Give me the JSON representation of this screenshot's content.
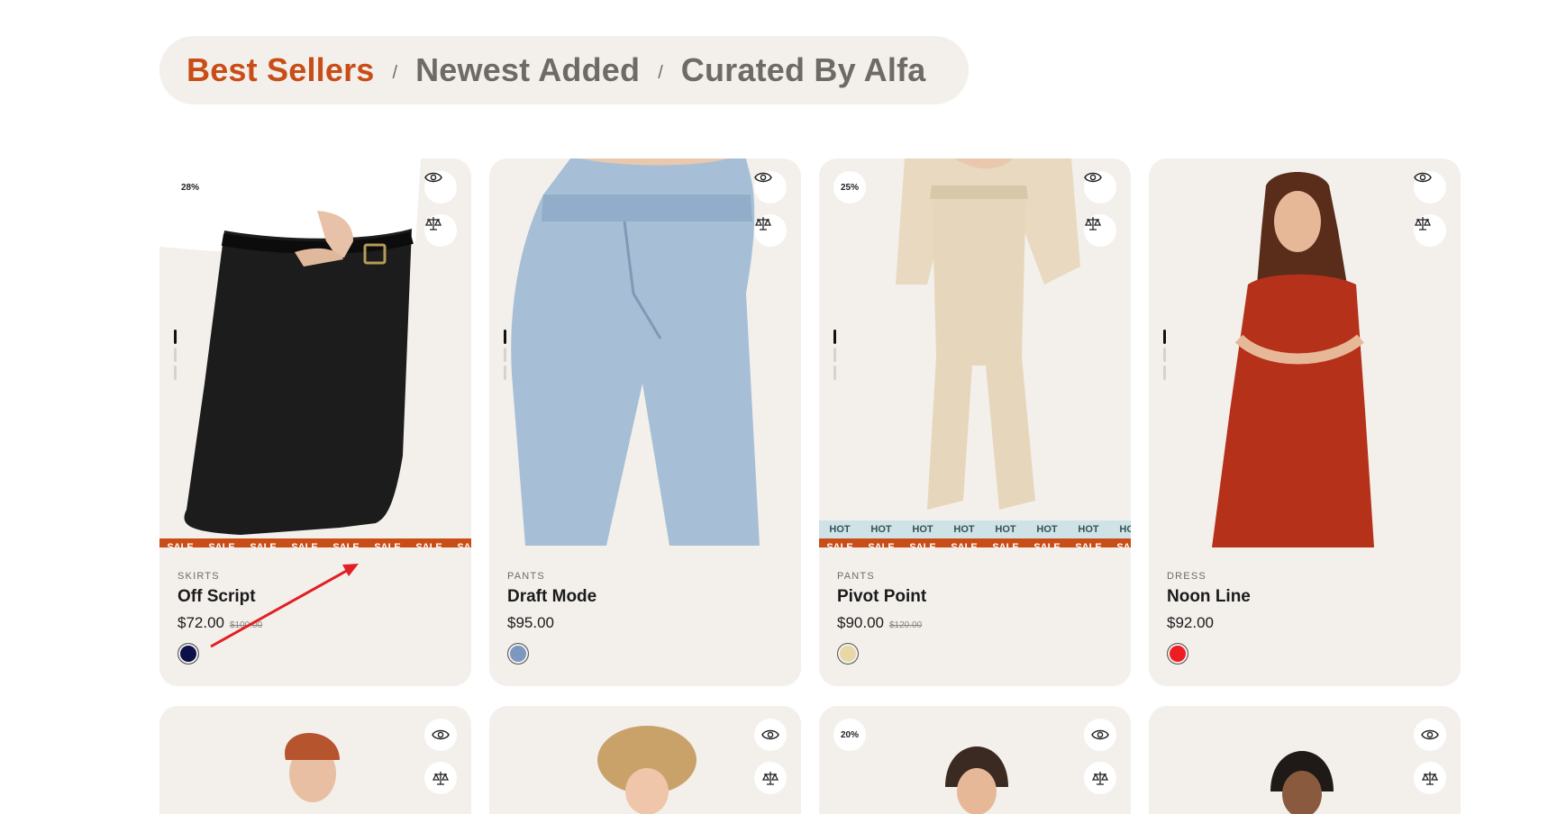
{
  "tabs": [
    {
      "label": "Best Sellers",
      "active": true
    },
    {
      "label": "Newest Added",
      "active": false
    },
    {
      "label": "Curated By Alfa",
      "active": false
    }
  ],
  "tab_separator": "/",
  "marquee_words": {
    "sale": "SALE",
    "hot": "HOT"
  },
  "products": [
    {
      "category": "SKIRTS",
      "name": "Off Script",
      "price": "$72.00",
      "old_price": "$100.00",
      "discount": "28%",
      "swatch": "#0d0f4a",
      "sale_band": true,
      "hot_band": false
    },
    {
      "category": "PANTS",
      "name": "Draft Mode",
      "price": "$95.00",
      "old_price": "",
      "discount": "",
      "swatch": "#7b99c0",
      "sale_band": false,
      "hot_band": false
    },
    {
      "category": "PANTS",
      "name": "Pivot Point",
      "price": "$90.00",
      "old_price": "$120.00",
      "discount": "25%",
      "swatch": "#e8d8a8",
      "sale_band": true,
      "hot_band": true
    },
    {
      "category": "DRESS",
      "name": "Noon Line",
      "price": "$92.00",
      "old_price": "",
      "discount": "",
      "swatch": "#ee1c23",
      "sale_band": false,
      "hot_band": false
    }
  ],
  "row2": [
    {
      "discount": ""
    },
    {
      "discount": ""
    },
    {
      "discount": "20%"
    },
    {
      "discount": ""
    }
  ],
  "icons": {
    "quick_view": "eye-icon",
    "compare": "scale-icon"
  },
  "colors": {
    "accent": "#c94d16",
    "card_bg": "#f3f0ec",
    "annotation": "#e31e24"
  }
}
